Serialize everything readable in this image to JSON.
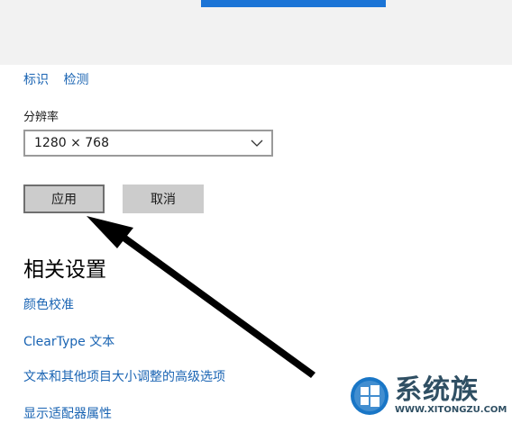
{
  "links": {
    "identify": "标识",
    "detect": "检测"
  },
  "resolution": {
    "label": "分辨率",
    "selected": "1280 × 768"
  },
  "buttons": {
    "apply": "应用",
    "cancel": "取消"
  },
  "related": {
    "title": "相关设置",
    "items": [
      "颜色校准",
      "ClearType 文本",
      "文本和其他项目大小调整的高级选项",
      "显示适配器属性"
    ]
  },
  "watermark": {
    "name": "系统族",
    "url": "WWW.XITONGZU.COM"
  },
  "colors": {
    "accent": "#1b74d6",
    "link": "#1a64b3",
    "button": "#cccccc"
  },
  "icons": [
    "chevron-down-icon",
    "windows-logo-icon",
    "annotation-arrow"
  ]
}
